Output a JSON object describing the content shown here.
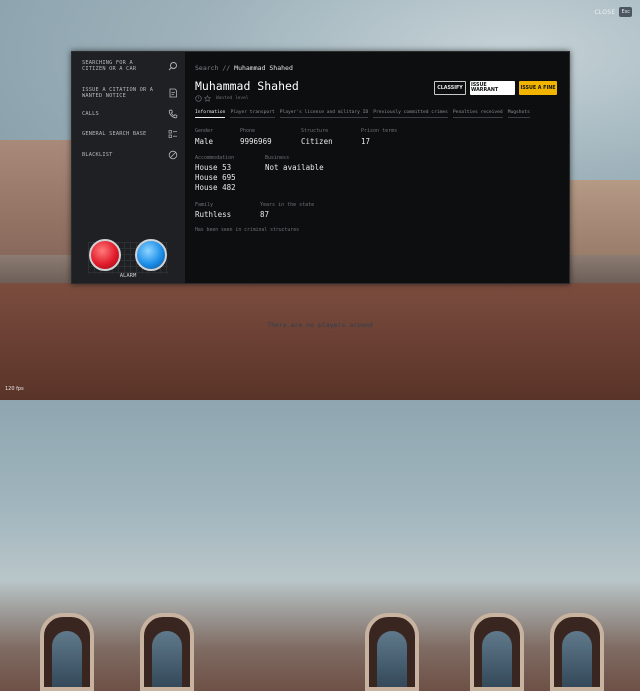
{
  "hud": {
    "close_label": "CLOSE",
    "close_key": "Esc",
    "fps": "120 fps",
    "no_players": "There are no players around"
  },
  "sidebar": {
    "items": [
      {
        "label": "SEARCHING FOR A CITIZEN OR A CAR",
        "icon": "search-icon"
      },
      {
        "label": "ISSUE A CITATION OR A WANTED NOTICE",
        "icon": "document-icon"
      },
      {
        "label": "CALLS",
        "icon": "phone-icon"
      },
      {
        "label": "GENERAL SEARCH BASE",
        "icon": "database-list-icon"
      },
      {
        "label": "BLACKLIST",
        "icon": "blocked-icon"
      }
    ],
    "alarm_label": "ALARM"
  },
  "header": {
    "crumb_root": "Search //",
    "crumb_current": "Muhammad Shahed",
    "title": "Muhammad Shahed",
    "wanted_text": "Wanted level",
    "wanted_stars_total": 1,
    "wanted_level": 0
  },
  "actions": {
    "classify": "CLASSIFY",
    "warrant": "ISSUE WARRANT",
    "fine": "ISSUE A FINE"
  },
  "tabs": [
    {
      "label": "Information",
      "active": true
    },
    {
      "label": "Player transport",
      "active": false
    },
    {
      "label": "Player's license and military ID",
      "active": false
    },
    {
      "label": "Previously committed crimes",
      "active": false
    },
    {
      "label": "Penalties received",
      "active": false
    },
    {
      "label": "Mugshots",
      "active": false
    }
  ],
  "info": {
    "gender_label": "Gender",
    "gender": "Male",
    "phone_label": "Phone",
    "phone": "9996969",
    "structure_label": "Structure",
    "structure": "Citizen",
    "prison_label": "Prison terms",
    "prison": "17",
    "accommodation_label": "Accommodation",
    "accommodation": [
      "House 53",
      "House 695",
      "House 482"
    ],
    "business_label": "Business",
    "business": "Not available",
    "family_label": "Family",
    "family": "Ruthless",
    "years_label": "Years in the state",
    "years": "87",
    "note": "Has been seen in criminal structures"
  },
  "colors": {
    "fine_button": "#f3b400",
    "alarm_red": "#e21b2b",
    "alarm_blue": "#1c8ee9"
  }
}
